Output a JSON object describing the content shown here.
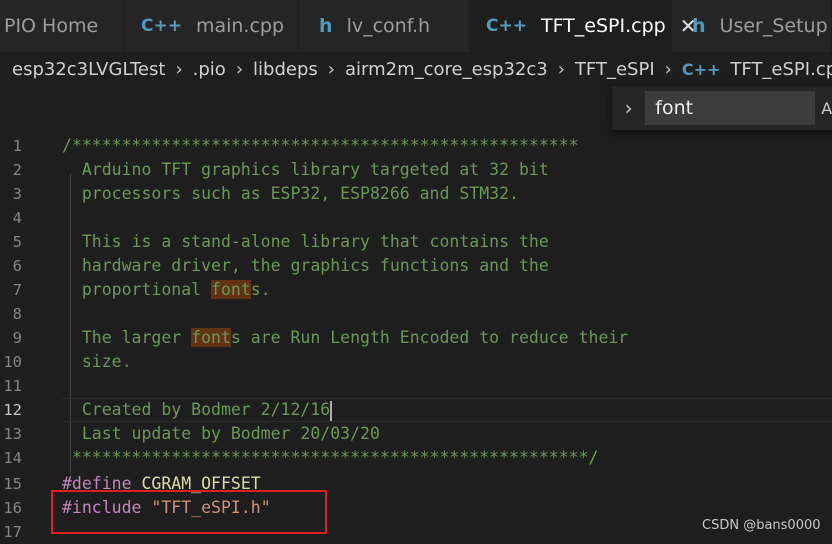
{
  "tabs": [
    {
      "label": "PIO Home",
      "icon": "none"
    },
    {
      "label": "main.cpp",
      "icon": "cpp-file-icon",
      "icon_text": "C++"
    },
    {
      "label": "lv_conf.h",
      "icon": "header-file-icon",
      "icon_text": "h"
    },
    {
      "label": "TFT_eSPI.cpp",
      "icon": "cpp-file-icon",
      "icon_text": "C++",
      "close": "✕"
    },
    {
      "label": "User_Setup",
      "icon": "header-file-icon",
      "icon_text": "h"
    }
  ],
  "breadcrumb": {
    "items": [
      "esp32c3LVGLTest",
      ".pio",
      "libdeps",
      "airm2m_core_esp32c3",
      "TFT_eSPI"
    ],
    "file_icon": "C++",
    "file": "TFT_eSPI.cpp",
    "more": "..."
  },
  "find": {
    "toggle": "›",
    "value": "font",
    "case_label": "Aa"
  },
  "editor": {
    "current_line": "12",
    "lines": [
      {
        "n": "1"
      },
      {
        "n": "2"
      },
      {
        "n": "3"
      },
      {
        "n": "4"
      },
      {
        "n": "5"
      },
      {
        "n": "6"
      },
      {
        "n": "7"
      },
      {
        "n": "8"
      },
      {
        "n": "9"
      },
      {
        "n": "10"
      },
      {
        "n": "11"
      },
      {
        "n": "12"
      },
      {
        "n": "13"
      },
      {
        "n": "14"
      },
      {
        "n": "15"
      },
      {
        "n": "16"
      },
      {
        "n": "17"
      }
    ],
    "text": {
      "l1": "/***************************************************",
      "l2": "  Arduino TFT graphics library targeted at 32 bit",
      "l3": "  processors such as ESP32, ESP8266 and STM32.",
      "l5": "  This is a stand-alone library that contains the",
      "l6": "  hardware driver, the graphics functions and the",
      "l7_a": "  proportional ",
      "l7_hl": "font",
      "l7_b": "s.",
      "l9_a": "  The larger ",
      "l9_hl": "font",
      "l9_b": "s are Run Length Encoded to reduce their",
      "l10": "  size.",
      "l12": "  Created by Bodmer 2/12/16",
      "l13": "  Last update by Bodmer 20/03/20",
      "l14": " ****************************************************/",
      "l15_kw": "#define",
      "l15_mac": "CGRAM_OFFSET",
      "l16_kw": "#include",
      "l16_str": "\"TFT_eSPI.h\""
    }
  },
  "watermark": "CSDN @bans0000",
  "colors": {
    "comment": "#6a9955",
    "keyword": "#c586c0",
    "macro": "#dcdcaa",
    "string": "#ce9178",
    "find_highlight": "#613214",
    "annotation_box": "#e02020"
  }
}
